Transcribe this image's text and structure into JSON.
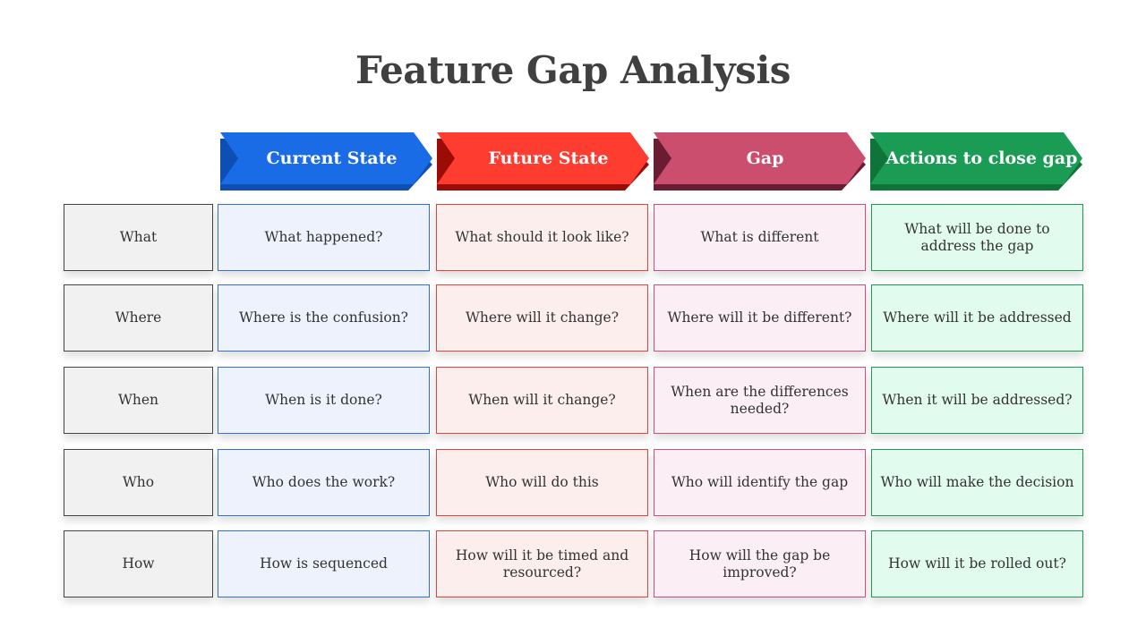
{
  "title": "Feature Gap Analysis",
  "headers": [
    {
      "label": "Current State",
      "color": "#1a6be6",
      "shade": "#0d4fb3"
    },
    {
      "label": "Future State",
      "color": "#fe3c30",
      "shade": "#9b0c06"
    },
    {
      "label": "Gap",
      "color": "#cb4e6f",
      "shade": "#6a1d32"
    },
    {
      "label": "Actions to close gap",
      "color": "#1a9c55",
      "shade": "#0f7439"
    }
  ],
  "rows": [
    {
      "label": "What",
      "cells": [
        "What happened?",
        "What should it look like?",
        "What is different",
        "What will be done to address the gap"
      ]
    },
    {
      "label": "Where",
      "cells": [
        "Where is the confusion?",
        "Where will it change?",
        "Where will it be different?",
        "Where will it be addressed"
      ]
    },
    {
      "label": "When",
      "cells": [
        "When is it done?",
        "When will it change?",
        "When are the differences needed?",
        "When it will be addressed?"
      ]
    },
    {
      "label": "Who",
      "cells": [
        "Who does the work?",
        "Who will do this",
        "Who will identify the gap",
        "Who will make the decision"
      ]
    },
    {
      "label": "How",
      "cells": [
        "How is sequenced",
        "How will it be timed and resourced?",
        "How will the gap be improved?",
        "How will it be rolled out?"
      ]
    }
  ]
}
